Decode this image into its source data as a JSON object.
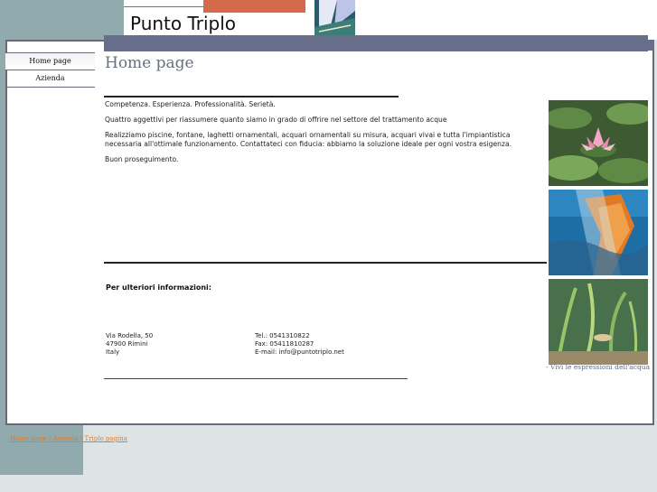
{
  "brand": {
    "title": "Punto Triplo"
  },
  "nav": {
    "items": [
      {
        "label": "Home page"
      },
      {
        "label": "Azienda"
      }
    ]
  },
  "main": {
    "title": "Home page",
    "paragraphs": [
      "Competenza. Esperienza. Professionalità. Serietà.",
      "Quattro aggettivi per riassumere quanto siamo in grado di offrire nel settore del trattamento acque",
      "Realizziamo piscine, fontane, laghetti ornamentali, acquari ornamentali su misura, acquari vivai e tutta l'impiantistica necessaria all'ottimale funzionamento. Contattateci con fiducia: abbiamo la soluzione ideale per ogni vostra esigenza.",
      "Buon proseguimento."
    ],
    "info_heading": "Per ulteriori informazioni:",
    "address": {
      "street": "Via Rodella, 50",
      "city": "47900 Rimini",
      "country": "Italy"
    },
    "contacts": {
      "tel": "Tel.: 0541310822",
      "fax": "Fax: 05411810287",
      "email": "E-mail: info@puntotriplo.net"
    }
  },
  "photo_caption": "- Vivi le espressioni dell'acqua",
  "footer": {
    "link": "Home page | Azienda | Triplo pagina"
  },
  "colors": {
    "accent_bar": "#676e8a",
    "side_band": "#90aaad",
    "brand_orange": "#d36a4a",
    "link": "#e07a2c"
  }
}
